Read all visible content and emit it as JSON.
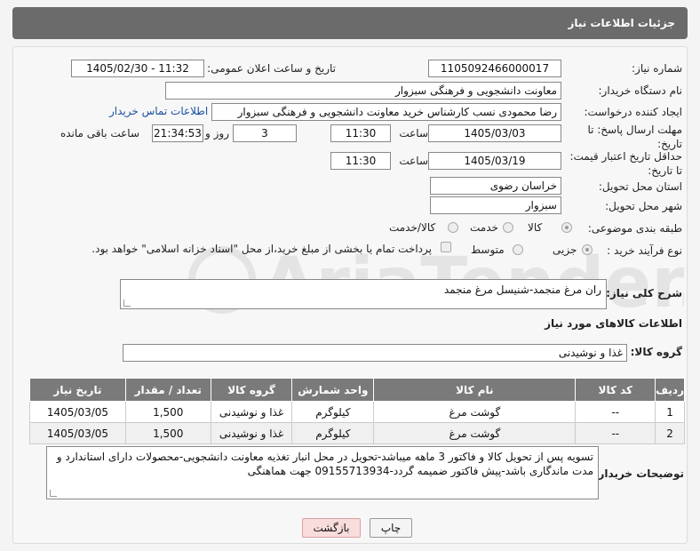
{
  "header": {
    "title": "جزئیات اطلاعات نیاز"
  },
  "form": {
    "need_number_label": "شماره نیاز:",
    "need_number": "1105092466000017",
    "announce_label": "تاریخ و ساعت اعلان عمومی:",
    "announce_value": "1405/02/30 - 11:32",
    "buyer_org_label": "نام دستگاه خریدار:",
    "buyer_org": "معاونت دانشجویی و فرهنگی سبزوار",
    "requester_label": "ایجاد کننده درخواست:",
    "requester": "رضا محمودی نسب کارشناس خرید معاونت دانشجویی و فرهنگی سبزوار",
    "buyer_contact_link": "اطلاعات تماس خریدار",
    "reply_deadline_label": "مهلت ارسال پاسخ: تا تاریخ:",
    "reply_date": "1405/03/03",
    "time_label": "ساعت",
    "reply_time": "11:30",
    "days_value": "3",
    "days_label": "روز و",
    "remaining_time": "21:34:53",
    "remaining_label": "ساعت باقی مانده",
    "price_validity_label": "حداقل تاریخ اعتبار قیمت: تا تاریخ:",
    "price_date": "1405/03/19",
    "price_time": "11:30",
    "province_label": "استان محل تحویل:",
    "province": "خراسان رضوی",
    "city_label": "شهر محل تحویل:",
    "city": "سبزوار",
    "category_label": "طبقه بندی موضوعی:",
    "category_options": [
      "کالا",
      "خدمت",
      "کالا/خدمت"
    ],
    "process_label": "نوع فرآیند خرید :",
    "process_options": [
      "جزیی",
      "متوسط"
    ],
    "payment_note": "پرداخت تمام یا بخشی از مبلغ خرید،از محل \"اسناد خزانه اسلامی\" خواهد بود.",
    "desc_label": "شرح کلی نیاز:",
    "desc_value": "ران مرغ منجمد-شنیسل مرغ منجمد",
    "goods_info_title": "اطلاعات کالاهای مورد نیاز",
    "goods_group_label": "گروه کالا:",
    "goods_group": "غذا و نوشیدنی",
    "buyer_notes_label": "توضیحات خریدار:",
    "buyer_notes": "تسویه پس از تحویل کالا و فاکتور 3 ماهه میباشد-تحویل در محل انبار تغذیه معاونت دانشجویی-محصولات دارای استاندارد و مدت ماندگاری باشد-پیش فاکتور ضمیمه گردد-09155713934 جهت هماهنگی"
  },
  "table": {
    "headers": [
      "ردیف",
      "کد کالا",
      "نام کالا",
      "واحد شمارش",
      "گروه کالا",
      "تعداد / مقدار",
      "تاریخ نیاز"
    ],
    "rows": [
      [
        "1",
        "--",
        "گوشت مرغ",
        "کیلوگرم",
        "غذا و نوشیدنی",
        "1,500",
        "1405/03/05"
      ],
      [
        "2",
        "--",
        "گوشت مرغ",
        "کیلوگرم",
        "غذا و نوشیدنی",
        "1,500",
        "1405/03/05"
      ]
    ]
  },
  "buttons": {
    "print": "چاپ",
    "back": "بازگشت"
  },
  "watermark": {
    "text": "AriaTender.net"
  },
  "colors": {
    "header": "#6b6b6b",
    "link": "#1a4fa0",
    "back_button": "#f9dcdc"
  }
}
